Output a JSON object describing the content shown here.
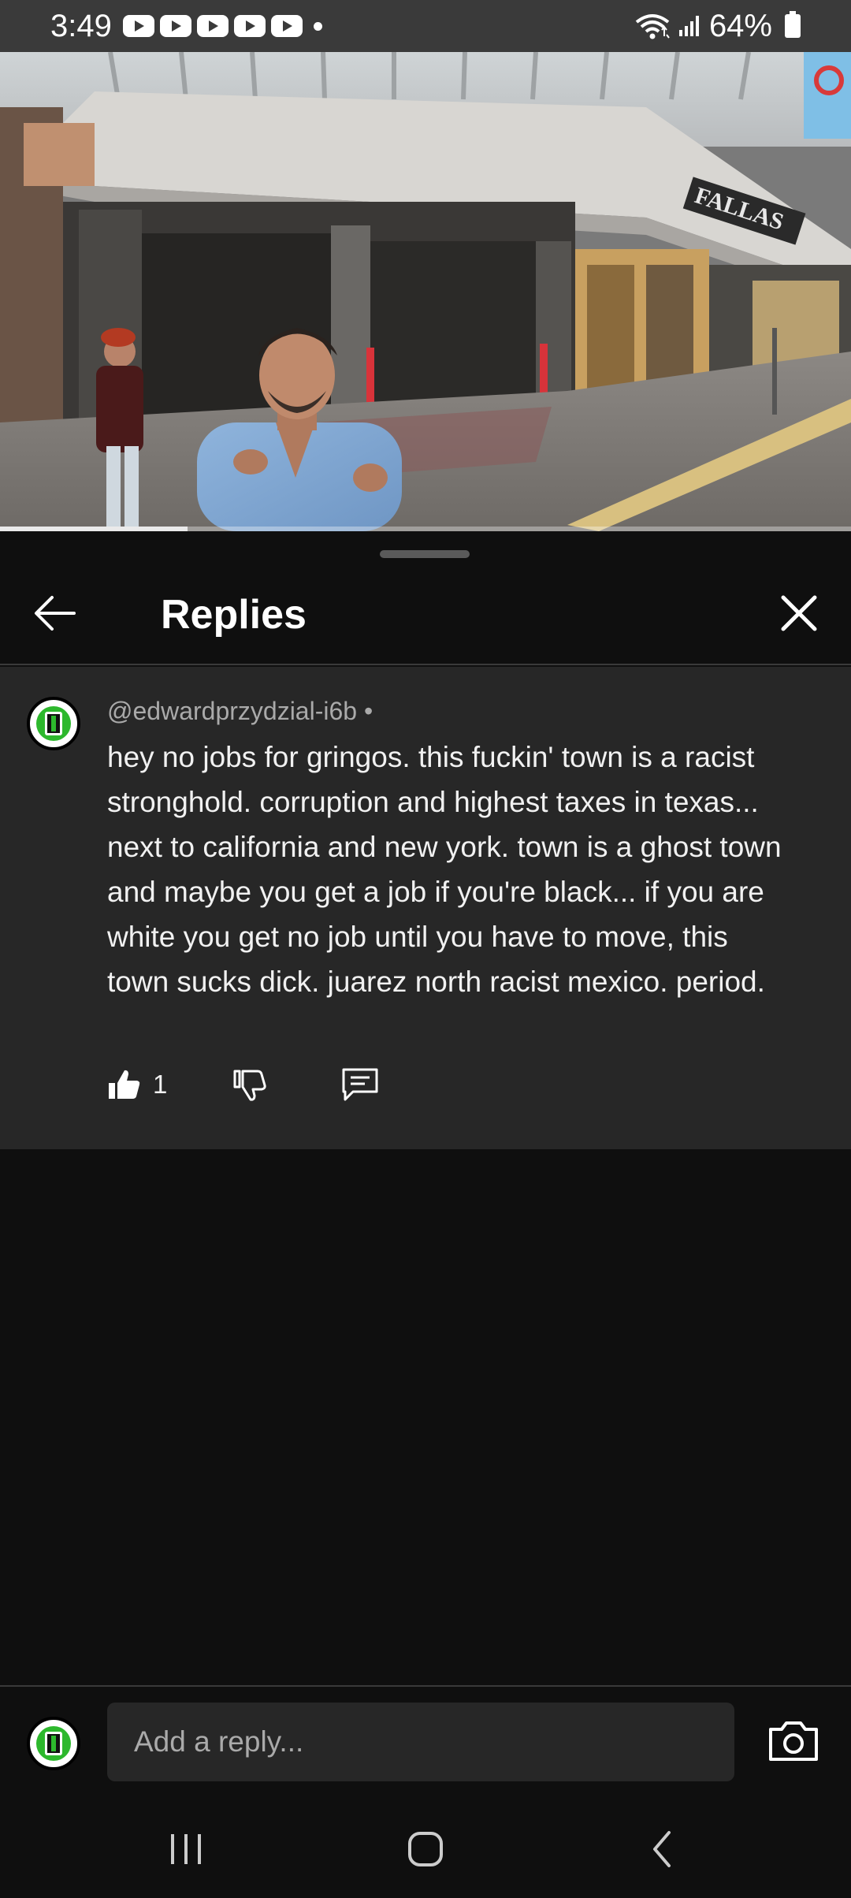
{
  "status_bar": {
    "time": "3:49",
    "battery": "64%",
    "notification_icons": [
      "youtube-icon",
      "youtube-icon",
      "youtube-icon",
      "youtube-icon",
      "youtube-icon"
    ]
  },
  "video": {
    "progress_fraction": 0.22,
    "sign_text": "FALLAS"
  },
  "panel": {
    "title": "Replies"
  },
  "comment": {
    "handle": "@edwardprzydzial-i6b •",
    "text": "hey no jobs for gringos. this fuckin' town is a racist stronghold. corruption and highest taxes in texas... next to california and new york. town is a ghost town and maybe you get a job if you're black... if you are white you get no job until you have to move, this town sucks dick. juarez north racist mexico. period.",
    "like_count": "1"
  },
  "reply": {
    "placeholder": "Add a reply..."
  },
  "colors": {
    "background": "#0f0f0f",
    "comment_bg": "#272727",
    "avatar_green": "#2db82d"
  }
}
